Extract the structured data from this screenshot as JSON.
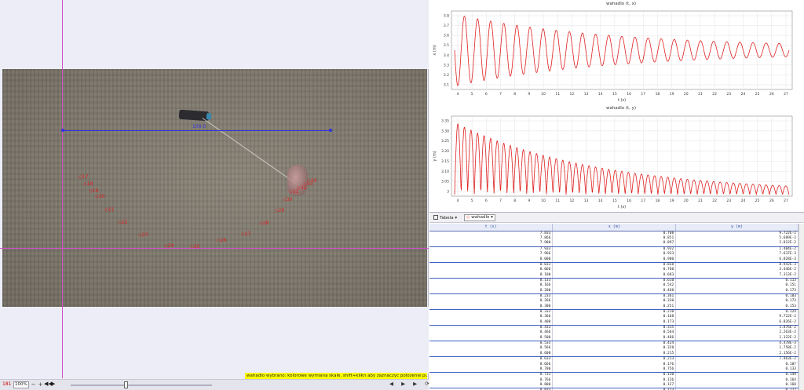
{
  "video": {
    "calibration_label": "100.0",
    "trail_labels": [
      "17",
      "18",
      "19",
      "20",
      "21",
      "22",
      "23",
      "24",
      "25",
      "26",
      "27",
      "28",
      "29",
      "30",
      "31",
      "32",
      "33",
      "34"
    ],
    "status_hint": "wahadlo wybrano: kolorowe wymiana skale, shift+klikn aby zaznaczyc polozenie punktu",
    "frame_counter": "181",
    "zoom_value": "100%",
    "zoom_minus": "−",
    "zoom_plus": "+",
    "step_back_glyph": "◀◀",
    "play_glyph": "▶",
    "loop_glyphs": "◀ ▶ ▶ ⟳"
  },
  "plot_top": {
    "title": "wahadlo (t, x)",
    "xlabel": "t (s)",
    "ylabel": "x (m)",
    "x_ticks": [
      "4",
      "5",
      "6",
      "7",
      "8",
      "9",
      "10",
      "11",
      "12",
      "13",
      "14",
      "15",
      "16",
      "17",
      "18",
      "19",
      "20",
      "21",
      "22",
      "23",
      "24",
      "25",
      "26",
      "27"
    ],
    "y_ticks": [
      "3.8",
      "3.7",
      "3.6",
      "3.5",
      "3.4",
      "3.3",
      "3.2",
      "3.1"
    ]
  },
  "plot_bottom": {
    "title": "wahadlo (t, y)",
    "xlabel": "t (s)",
    "ylabel": "y (m)",
    "x_ticks": [
      "4",
      "5",
      "6",
      "7",
      "8",
      "9",
      "10",
      "11",
      "12",
      "13",
      "14",
      "15",
      "16",
      "17",
      "18",
      "19",
      "20",
      "21",
      "22",
      "23",
      "24",
      "25",
      "26",
      "27"
    ],
    "y_ticks": [
      "3.35",
      "3.30",
      "3.25",
      "3.20",
      "3.15",
      "3.10",
      "3.05",
      "3"
    ]
  },
  "table": {
    "tab_label": "Tabela",
    "track_label": "wahadlo",
    "columns": [
      "t (s)",
      "x (m)",
      "y (m)"
    ],
    "rows": [
      [
        "7.833",
        "0.788",
        "9.722E-2"
      ],
      [
        "7.866",
        "0.851",
        "5.689E-2"
      ],
      [
        "7.900",
        "0.897",
        "2.812E-2"
      ],
      [
        "7.933",
        "0.932",
        "1.404E-2"
      ],
      [
        "7.966",
        "0.933",
        "7.637E-3"
      ],
      [
        "8.000",
        "0.900",
        "6.828E-3"
      ],
      [
        "8.033",
        "0.838",
        "8.942E-3"
      ],
      [
        "8.066",
        "0.760",
        "3.446E-2"
      ],
      [
        "8.100",
        "0.683",
        "7.313E-2"
      ],
      [
        "8.133",
        "0.610",
        "0.113"
      ],
      [
        "8.166",
        "0.542",
        "0.151"
      ],
      [
        "8.200",
        "0.468",
        "0.173"
      ],
      [
        "8.233",
        "0.361",
        "0.183"
      ],
      [
        "8.266",
        "0.330",
        "0.173"
      ],
      [
        "8.300",
        "0.251",
        "0.153"
      ],
      [
        "8.333",
        "0.210",
        "0.124"
      ],
      [
        "8.366",
        "0.168",
        "9.722E-2"
      ],
      [
        "8.400",
        "0.173",
        "6.826E-2"
      ],
      [
        "8.433",
        "0.315",
        "3.876E-2"
      ],
      [
        "8.466",
        "0.564",
        "2.263E-2"
      ],
      [
        "8.500",
        "0.466",
        "1.122E-2"
      ],
      [
        "8.533",
        "0.424",
        "4.478E-3"
      ],
      [
        "8.566",
        "0.328",
        "1.758E-2"
      ],
      [
        "8.600",
        "0.215",
        "2.156E-2"
      ],
      [
        "8.633",
        "0.213",
        "7.463E-2"
      ],
      [
        "8.666",
        "0.176",
        "0.107"
      ],
      [
        "8.700",
        "0.756",
        "0.133"
      ],
      [
        "8.733",
        "0.130",
        "0.149"
      ],
      [
        "8.766",
        "0.126",
        "0.164"
      ],
      [
        "8.800",
        "0.127",
        "0.168"
      ],
      [
        "8.833",
        "0.123",
        "0.172"
      ]
    ]
  },
  "colors": {
    "axis_magenta": "#d050c8",
    "calibration_blue": "#3030e0",
    "track_red": "#e02020",
    "hint_yellow": "#ffff00"
  }
}
